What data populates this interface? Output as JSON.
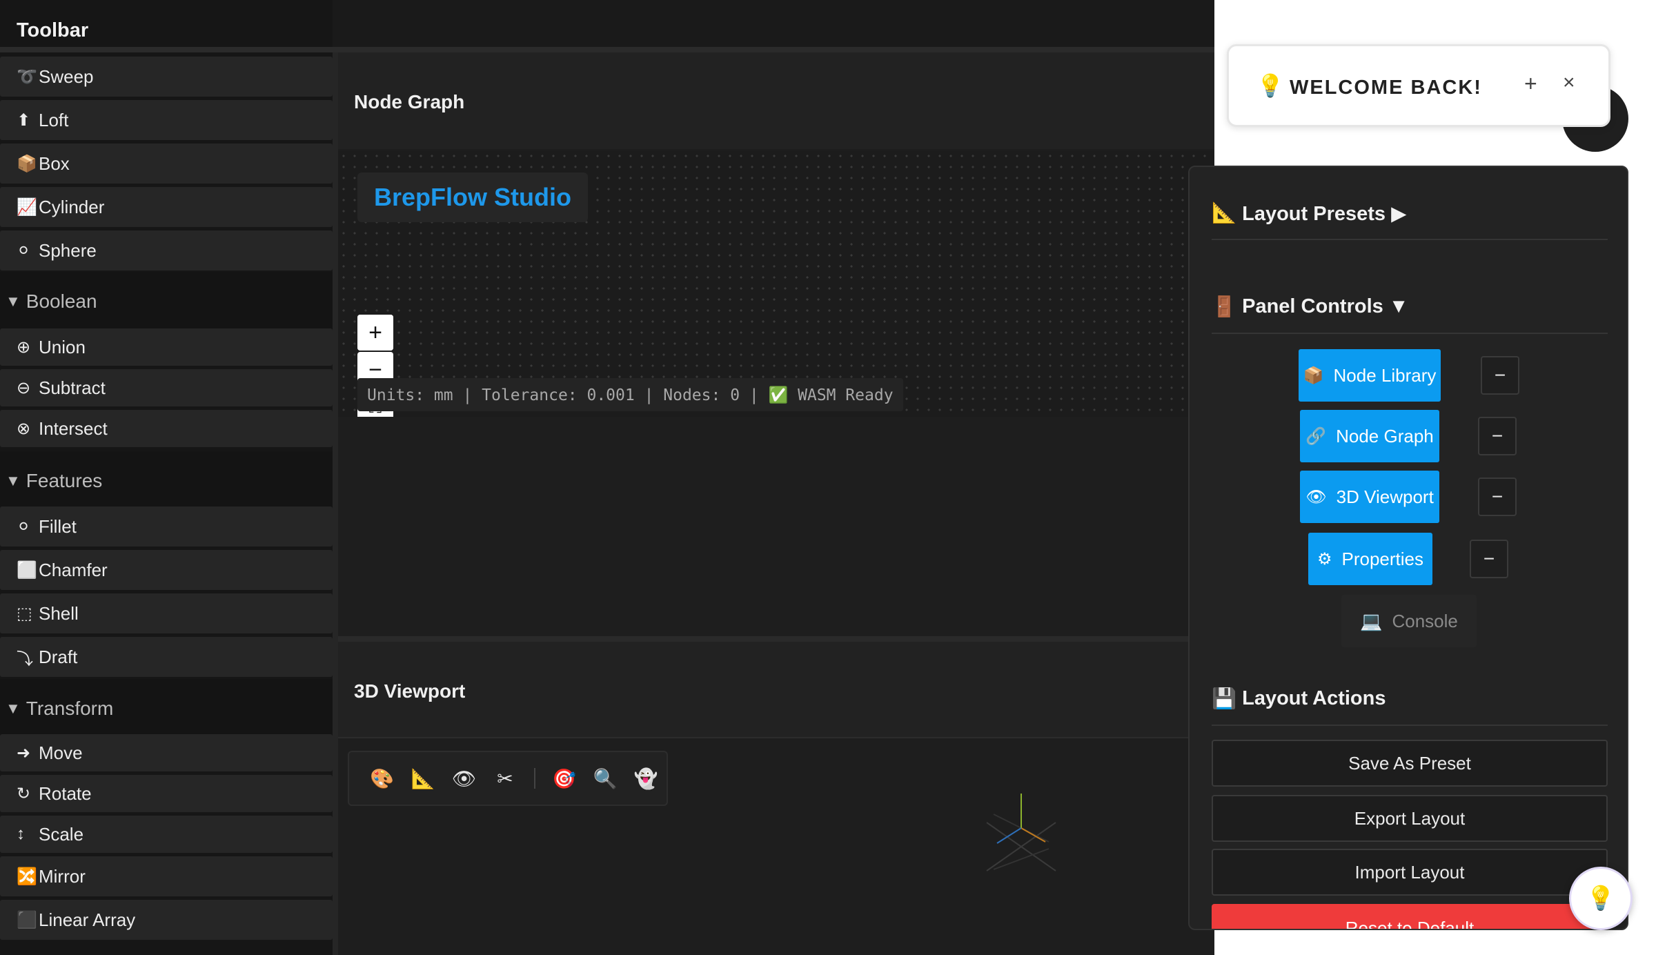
{
  "toolbar": {
    "title": "Toolbar",
    "primitives": [
      {
        "icon": "➰",
        "label": "Sweep"
      },
      {
        "icon": "⬆",
        "label": "Loft"
      },
      {
        "icon": "📦",
        "label": "Box"
      },
      {
        "icon": "📈",
        "label": "Cylinder"
      },
      {
        "icon": "⚪",
        "label": "Sphere"
      }
    ],
    "boolean": {
      "label": "Boolean",
      "items": [
        {
          "icon": "⊕",
          "label": "Union"
        },
        {
          "icon": "⊖",
          "label": "Subtract"
        },
        {
          "icon": "⊗",
          "label": "Intersect"
        }
      ]
    },
    "features": {
      "label": "Features",
      "items": [
        {
          "icon": "⚪",
          "label": "Fillet"
        },
        {
          "icon": "⬜",
          "label": "Chamfer"
        },
        {
          "icon": "⬚",
          "label": "Shell"
        },
        {
          "icon": "⤵",
          "label": "Draft"
        }
      ]
    },
    "transform": {
      "label": "Transform",
      "items": [
        {
          "icon": "➜",
          "label": "Move"
        },
        {
          "icon": "↻",
          "label": "Rotate"
        },
        {
          "icon": "↕",
          "label": "Scale"
        },
        {
          "icon": "🔀",
          "label": "Mirror"
        },
        {
          "icon": "⬛",
          "label": "Linear Array"
        }
      ]
    }
  },
  "node_graph": {
    "title": "Node Graph",
    "brand": "BrepFlow Studio",
    "zoom_in": "+",
    "zoom_out": "−",
    "fit": "⛶",
    "status": "Units: mm | Tolerance: 0.001 | Nodes: 0 | ✅ WASM Ready"
  },
  "viewport": {
    "title": "3D Viewport",
    "tools": [
      "🎨",
      "📐",
      "👁",
      "✂",
      "🎯",
      "🔍",
      "👻"
    ]
  },
  "welcome": {
    "icon": "💡",
    "text": "WELCOME BACK!",
    "plus": "+",
    "close": "×"
  },
  "layout_panel": {
    "presets": {
      "icon": "📐",
      "label": "Layout Presets ▶"
    },
    "panel_controls": {
      "icon": "🚪",
      "label": "Panel Controls ▼"
    },
    "buttons": [
      {
        "icon": "📦",
        "label": "Node Library",
        "minus": "−"
      },
      {
        "icon": "🔗",
        "label": "Node Graph",
        "minus": "−"
      },
      {
        "icon": "👁",
        "label": "3D Viewport",
        "minus": "−"
      },
      {
        "icon": "⚙",
        "label": "Properties",
        "minus": "−"
      }
    ],
    "console": {
      "icon": "💻",
      "label": "Console"
    },
    "actions": {
      "icon": "💾",
      "label": "Layout Actions",
      "save": "Save As Preset",
      "export": "Export Layout",
      "import": "Import Layout",
      "reset": "Reset to Default"
    }
  },
  "fab": {
    "icon": "💡"
  },
  "colors": {
    "accent": "#0b9bf0",
    "brand": "#1e98ea",
    "danger": "#ef3b3b"
  }
}
